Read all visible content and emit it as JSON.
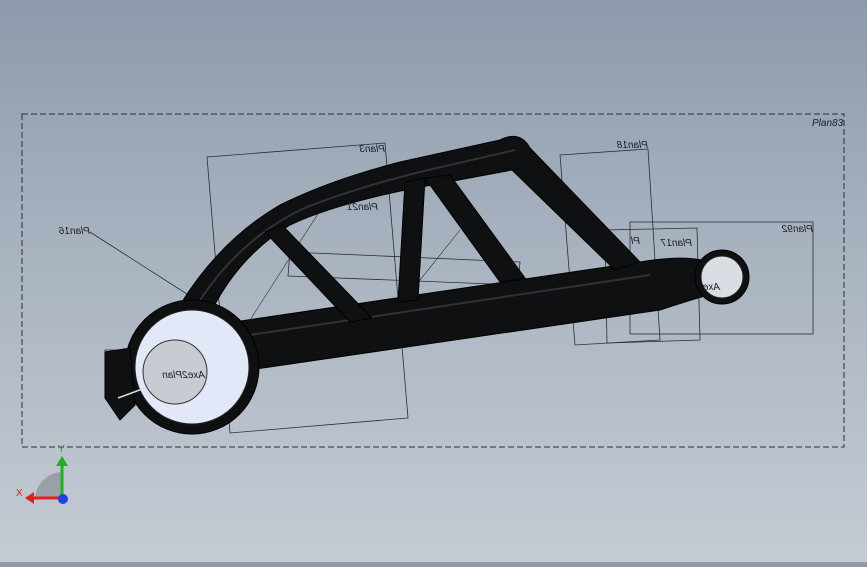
{
  "viewport": {
    "bounding_box_label": "Plan83"
  },
  "planes": [
    {
      "id": "plan3",
      "label": "Plan3"
    },
    {
      "id": "plan18",
      "label": "Plan18"
    },
    {
      "id": "plan16",
      "label": "Plan16"
    },
    {
      "id": "plan21",
      "label": "Plan21"
    },
    {
      "id": "plan17",
      "label": "Plan17"
    },
    {
      "id": "plan92",
      "label": "Plan92"
    },
    {
      "id": "plan-fragment",
      "label": "Pl"
    }
  ],
  "axes": [
    {
      "id": "axe2plan",
      "label": "Axe2Plan"
    },
    {
      "id": "axe-small",
      "label": "Axe"
    }
  ],
  "triad": {
    "x_label": "X",
    "y_label": "Y",
    "colors": {
      "x": "#e02020",
      "y": "#22b022",
      "z": "#2040e0"
    }
  }
}
